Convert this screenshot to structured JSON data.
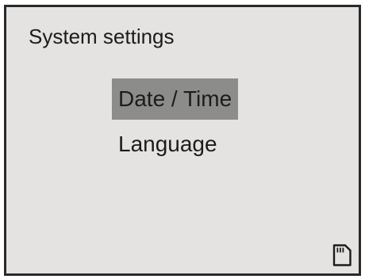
{
  "screen": {
    "title": "System settings",
    "menu": [
      {
        "label": "Date / Time",
        "selected": true
      },
      {
        "label": "Language",
        "selected": false
      }
    ],
    "status_icon": "sd-card-icon"
  },
  "colors": {
    "background": "#e4e3e1",
    "selection": "#8c8c8a",
    "text": "#1c1c1c",
    "border": "#2a2a2a"
  }
}
